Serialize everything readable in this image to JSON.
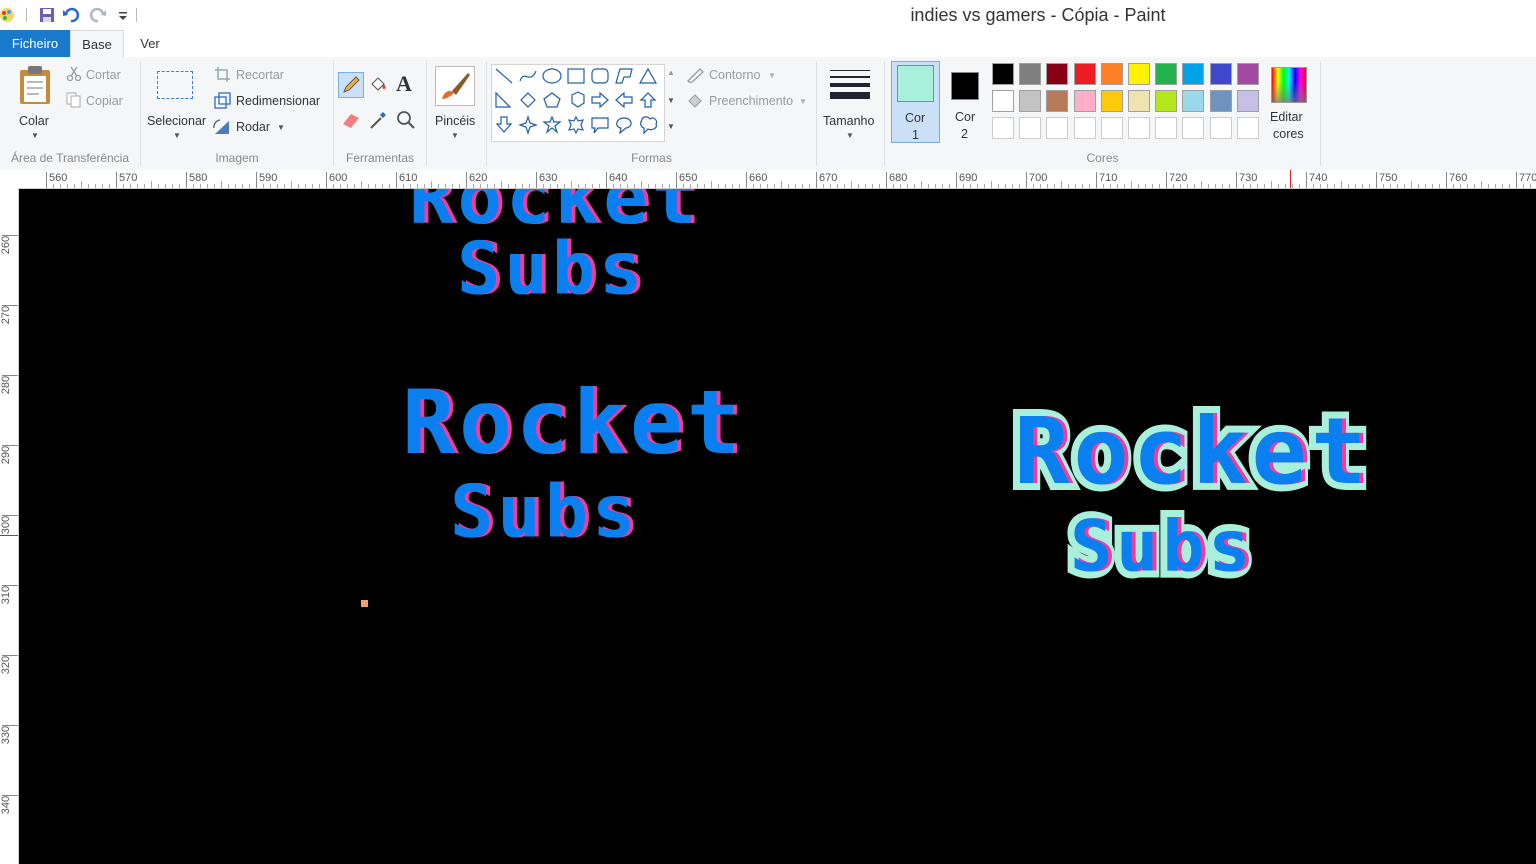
{
  "window": {
    "title": "indies vs gamers - Cópia - Paint"
  },
  "quick_access": {
    "icons": [
      "paint-app-icon",
      "save-icon",
      "undo-icon",
      "redo-icon",
      "customize-caret-icon"
    ]
  },
  "tabs": {
    "file": "Ficheiro",
    "home": "Base",
    "view": "Ver"
  },
  "ribbon": {
    "clipboard": {
      "paste": "Colar",
      "cut": "Cortar",
      "copy": "Copiar",
      "group": "Área de Transferência"
    },
    "image": {
      "select": "Selecionar",
      "crop": "Recortar",
      "resize": "Redimensionar",
      "rotate": "Rodar",
      "group": "Imagem"
    },
    "tools": {
      "group": "Ferramentas"
    },
    "brushes": {
      "label": "Pincéis"
    },
    "shapes": {
      "outline": "Contorno",
      "fill": "Preenchimento",
      "group": "Formas"
    },
    "size": {
      "label": "Tamanho"
    },
    "colors": {
      "color1_line1": "Cor",
      "color1_line2": "1",
      "color2_line1": "Cor",
      "color2_line2": "2",
      "color1": "#a8f0dc",
      "color2": "#000000",
      "edit_line1": "Editar",
      "edit_line2": "cores",
      "group": "Cores",
      "palette_row1": [
        "#000000",
        "#7f7f7f",
        "#880015",
        "#ed1c24",
        "#ff7f27",
        "#fff200",
        "#22b14c",
        "#00a2e8",
        "#3f48cc",
        "#a349a4"
      ],
      "palette_row2": [
        "#ffffff",
        "#c3c3c3",
        "#b97a57",
        "#ffaec9",
        "#ffc90e",
        "#efe4b0",
        "#b5e61d",
        "#99d9ea",
        "#7092be",
        "#c8bfe7"
      ]
    }
  },
  "rulers": {
    "horizontal": [
      "560",
      "570",
      "580",
      "590",
      "600",
      "610",
      "620",
      "630",
      "640",
      "650",
      "660",
      "670",
      "680",
      "690",
      "700",
      "710",
      "720",
      "730",
      "740",
      "750",
      "760",
      "770"
    ],
    "vertical": [
      "260",
      "270",
      "280",
      "290",
      "300",
      "310",
      "320",
      "330",
      "340"
    ]
  },
  "canvas": {
    "logo_top_line": "Rocket",
    "logo_bottom_line": "Subs",
    "logo_colors": {
      "primary": "#0a7ff0",
      "shadow": "#f03ca0",
      "dark": "#3a10c8",
      "highlight": "#f0e0b0",
      "outline": "#a8f0dc",
      "background": "#000000",
      "dot": "#f0a070"
    }
  }
}
